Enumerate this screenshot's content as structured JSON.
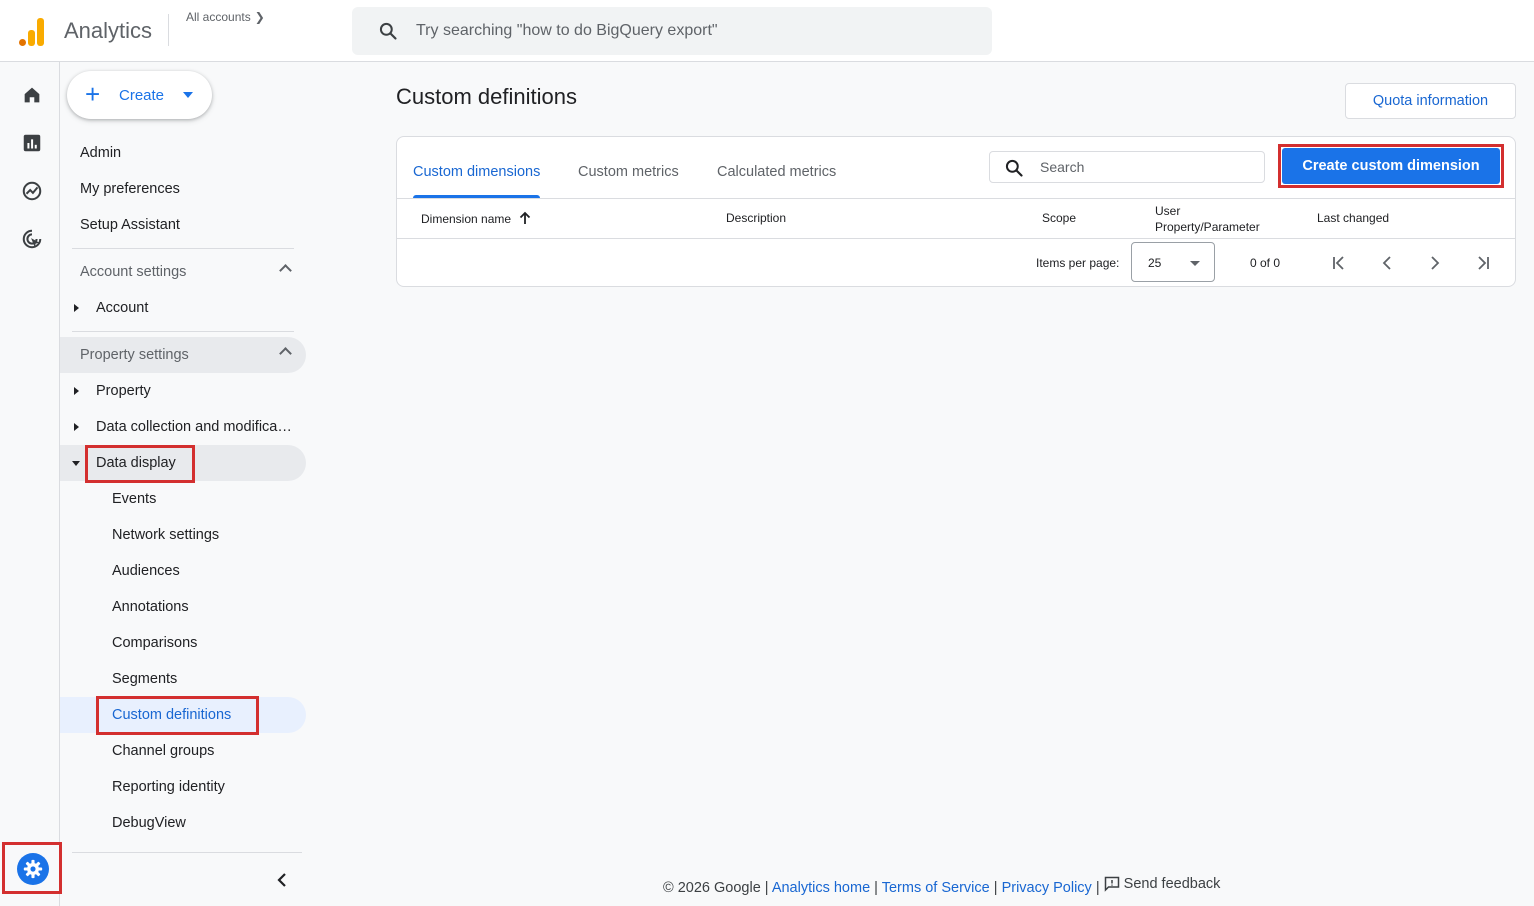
{
  "header": {
    "app_title": "Analytics",
    "all_accounts": "All accounts",
    "search_placeholder": "Try searching \"how to do BigQuery export\""
  },
  "rail": {
    "icons": [
      "home-icon",
      "reports-icon",
      "explore-icon",
      "advertising-icon"
    ],
    "settings_icon": "gear-icon"
  },
  "nav": {
    "create_label": "Create",
    "top_items": [
      "Admin",
      "My preferences",
      "Setup Assistant"
    ],
    "account_settings": {
      "header": "Account settings",
      "items": [
        "Account"
      ]
    },
    "property_settings": {
      "header": "Property settings",
      "items": [
        "Property",
        "Data collection and modifica…",
        "Data display"
      ],
      "data_display_children": [
        "Events",
        "Network settings",
        "Audiences",
        "Annotations",
        "Comparisons",
        "Segments",
        "Custom definitions",
        "Channel groups",
        "Reporting identity",
        "DebugView"
      ]
    },
    "active_item": "Custom definitions"
  },
  "main": {
    "page_title": "Custom definitions",
    "quota_button": "Quota information",
    "tabs": [
      "Custom dimensions",
      "Custom metrics",
      "Calculated metrics"
    ],
    "selected_tab": "Custom dimensions",
    "search_placeholder": "Search",
    "create_button": "Create custom dimension",
    "columns": [
      "Dimension name",
      "Description",
      "Scope",
      "User Property/Parameter",
      "Last changed"
    ],
    "column_user_prop_line1": "User",
    "column_user_prop_line2": "Property/Parameter",
    "items_per_page_label": "Items per page:",
    "items_per_page_value": "25",
    "range_label": "0 of 0"
  },
  "footer": {
    "copyright": "© 2026 Google",
    "links": [
      "Analytics home",
      "Terms of Service",
      "Privacy Policy"
    ],
    "sep": "|",
    "feedback": "Send feedback"
  },
  "colors": {
    "accent": "#1a73e8",
    "highlight_box": "#d32f2f",
    "active_nav_bg": "#e8f0fe"
  }
}
